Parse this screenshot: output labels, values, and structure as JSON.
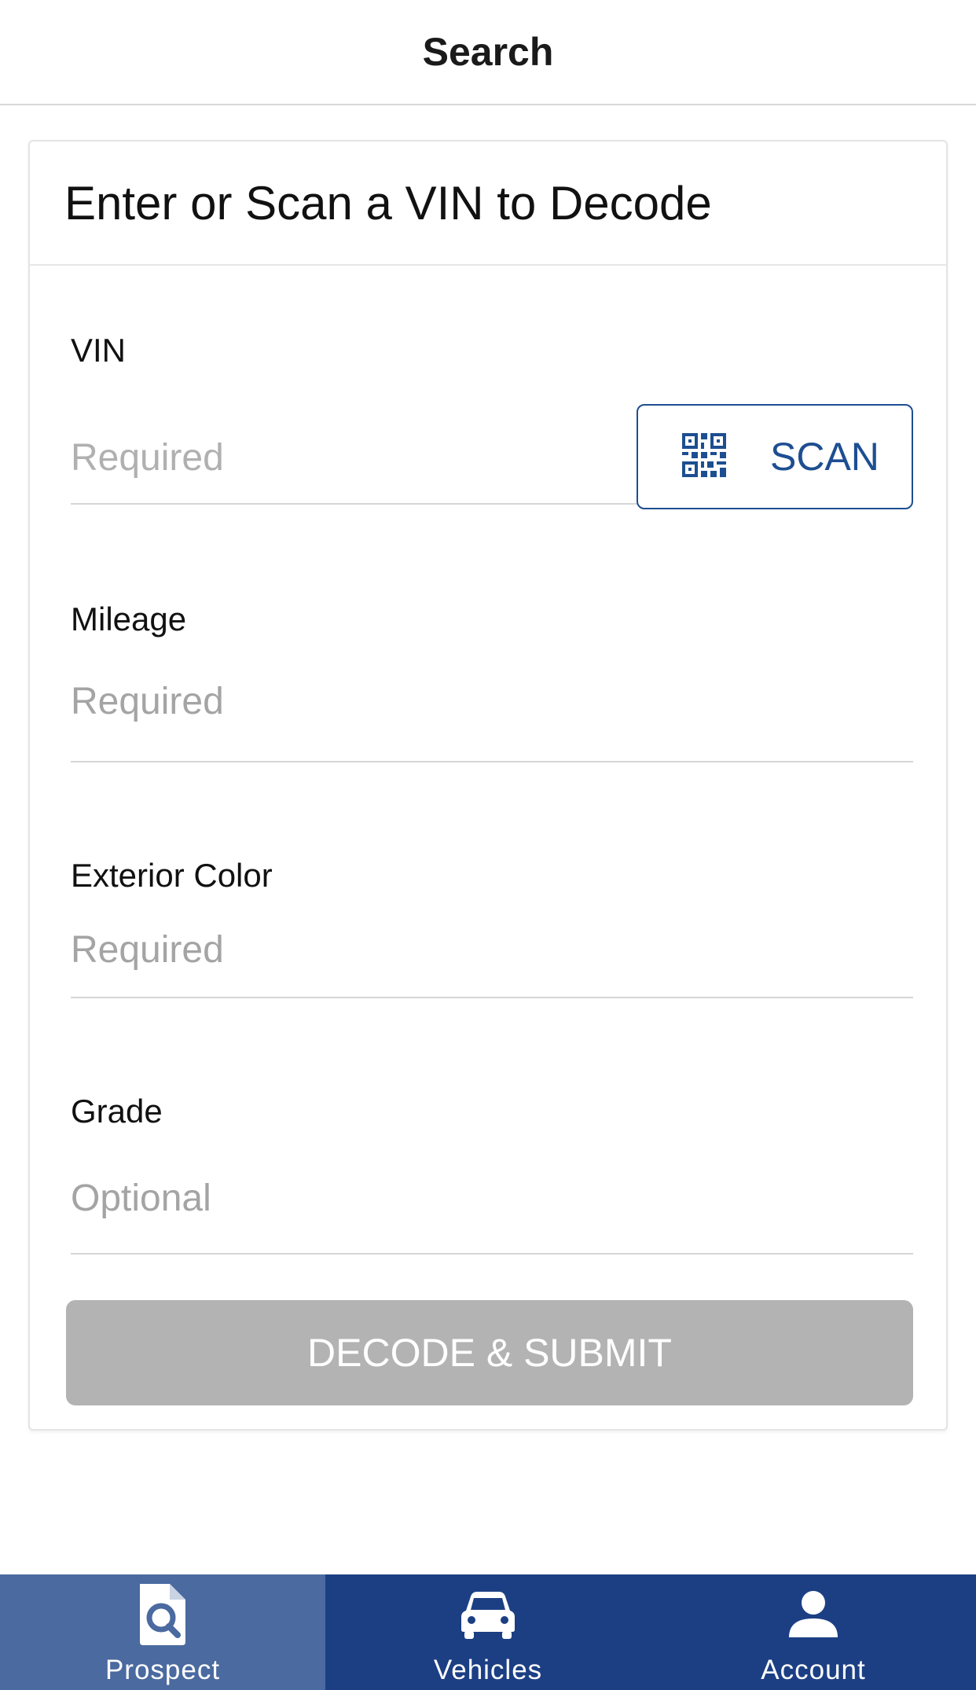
{
  "header": {
    "title": "Search"
  },
  "card": {
    "title": "Enter or Scan a VIN to Decode"
  },
  "form": {
    "vin": {
      "label": "VIN",
      "placeholder": "Required",
      "scan_label": "SCAN"
    },
    "mileage": {
      "label": "Mileage",
      "placeholder": "Required"
    },
    "exterior_color": {
      "label": "Exterior Color",
      "placeholder": "Required"
    },
    "grade": {
      "label": "Grade",
      "placeholder": "Optional"
    },
    "submit_label": "DECODE & SUBMIT"
  },
  "tabbar": {
    "active": "prospect",
    "tabs": [
      {
        "label": "Prospect",
        "icon": "document-search-icon"
      },
      {
        "label": "Vehicles",
        "icon": "car-icon"
      },
      {
        "label": "Account",
        "icon": "person-icon"
      }
    ]
  },
  "colors": {
    "accent": "#1d4e91",
    "tabbar": "#1c3f84",
    "tab_active": "#4a6aa0",
    "submit_disabled": "#b3b3b3"
  }
}
